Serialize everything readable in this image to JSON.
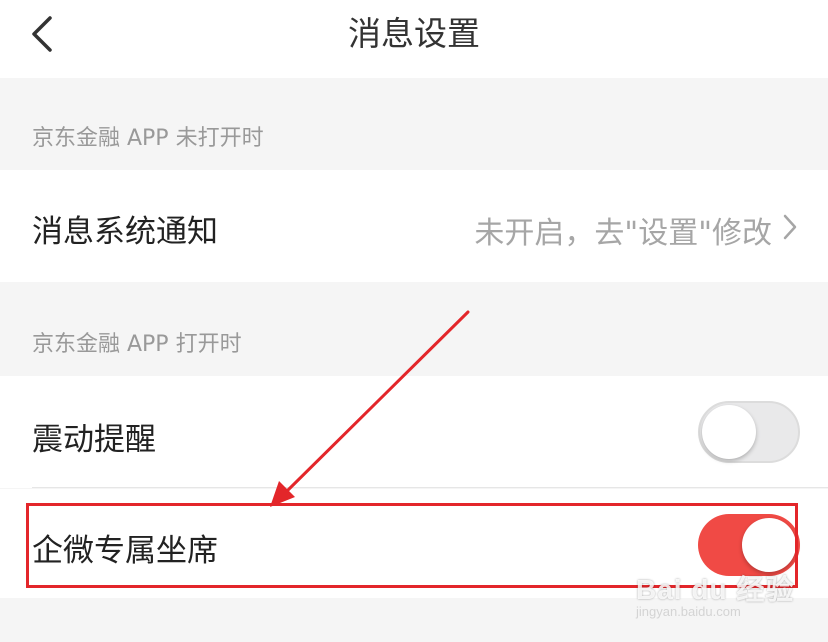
{
  "header": {
    "title": "消息设置",
    "back_icon": "chevron-left-icon"
  },
  "sections": [
    {
      "label": "京东金融 APP 未打开时",
      "rows": [
        {
          "label": "消息系统通知",
          "value": "未开启，去\"设置\"修改",
          "icon": "chevron-right-icon"
        }
      ]
    },
    {
      "label": "京东金融 APP 打开时",
      "rows": [
        {
          "label": "震动提醒",
          "toggle": false
        },
        {
          "label": "企微专属坐席",
          "toggle": true
        }
      ]
    }
  ],
  "colors": {
    "accent": "#f04a45",
    "annotation": "#e3262a",
    "background": "#f5f5f5",
    "muted_text": "#999999"
  },
  "watermark": {
    "brand": "Bai du 经验",
    "url": "jingyan.baidu.com"
  }
}
